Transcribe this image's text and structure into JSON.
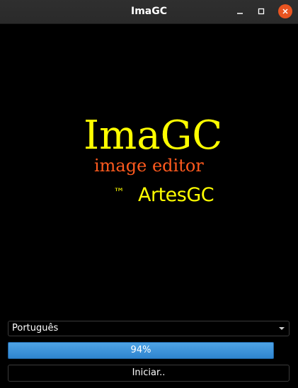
{
  "window": {
    "title": "ImaGC"
  },
  "icons": {
    "minimize": "minimize-icon",
    "maximize": "maximize-icon",
    "close": "close-icon",
    "dropdown": "chevron-down-icon"
  },
  "splash": {
    "app_name": "ImaGC",
    "subtitle": "image editor",
    "trademark": "™",
    "brand": "ArtesGC"
  },
  "colors": {
    "background": "#000000",
    "logo_primary": "#ffff00",
    "logo_subtitle": "#ff5a1e",
    "close_button": "#e95420",
    "progress_fill": "#3a93dc"
  },
  "language_select": {
    "selected": "Português"
  },
  "progress": {
    "value": 0.94,
    "label": "94%"
  },
  "start_button": {
    "label": "Iniciar.."
  }
}
